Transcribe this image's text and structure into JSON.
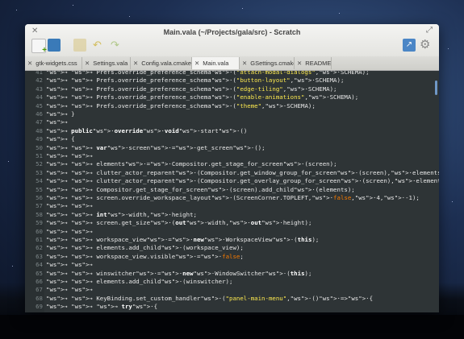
{
  "window": {
    "title": "Main.vala (~/Projects/gala/src) - Scratch"
  },
  "tabs": [
    {
      "label": "gtk-widgets.css",
      "active": false
    },
    {
      "label": "Settings.vala",
      "active": false
    },
    {
      "label": "Config.vala.cmake",
      "active": false
    },
    {
      "label": "Main.vala",
      "active": true
    },
    {
      "label": "GSettings.cmake",
      "active": false
    },
    {
      "label": "README",
      "active": false
    }
  ],
  "toolbar": {
    "icons": [
      "new-document-icon",
      "open-folder-icon",
      "save-icon",
      "undo-icon",
      "redo-icon",
      "share-icon",
      "settings-gear-icon"
    ]
  },
  "colors": {
    "editor_bg": "#2e3436",
    "keyword": "#ffffff",
    "string": "#fce94f",
    "boolean": "#f57900",
    "number": "#ad7fa8"
  },
  "code_lines": [
    {
      "n": "41",
      "text": "→ → Prefs.override_preference_schema·(\"attach-modal-dialogs\",·SCHEMA);"
    },
    {
      "n": "42",
      "text": "→ → Prefs.override_preference_schema·(\"button-layout\",·SCHEMA);"
    },
    {
      "n": "43",
      "text": "→ → Prefs.override_preference_schema·(\"edge-tiling\",·SCHEMA);"
    },
    {
      "n": "44",
      "text": "→ → Prefs.override_preference_schema·(\"enable-animations\",·SCHEMA);"
    },
    {
      "n": "45",
      "text": "→ → Prefs.override_preference_schema·(\"theme\",·SCHEMA);"
    },
    {
      "n": "46",
      "text": "→ }"
    },
    {
      "n": "47",
      "text": "→"
    },
    {
      "n": "48",
      "text": "→ public·override·void·start·()"
    },
    {
      "n": "49",
      "text": "→ {"
    },
    {
      "n": "50",
      "text": "→ → var·screen·=·get_screen·();"
    },
    {
      "n": "51",
      "text": "→ →"
    },
    {
      "n": "52",
      "text": "→ → elements·=·Compositor.get_stage_for_screen·(screen);"
    },
    {
      "n": "53",
      "text": "→ → clutter_actor_reparent·(Compositor.get_window_group_for_screen·(screen),·elements);"
    },
    {
      "n": "54",
      "text": "→ → clutter_actor_reparent·(Compositor.get_overlay_group_for_screen·(screen),·elements);"
    },
    {
      "n": "55",
      "text": "→ → Compositor.get_stage_for_screen·(screen).add_child·(elements);"
    },
    {
      "n": "56",
      "text": "→ → screen.override_workspace_layout·(ScreenCorner.TOPLEFT,·false,·4,·-1);"
    },
    {
      "n": "57",
      "text": "→ →"
    },
    {
      "n": "58",
      "text": "→ → int·width,·height;"
    },
    {
      "n": "59",
      "text": "→ → screen.get_size·(out·width,·out·height);"
    },
    {
      "n": "60",
      "text": "→ →"
    },
    {
      "n": "61",
      "text": "→ → workspace_view·=·new·WorkspaceView·(this);"
    },
    {
      "n": "62",
      "text": "→ → elements.add_child·(workspace_view);"
    },
    {
      "n": "63",
      "text": "→ → workspace_view.visible·=·false;"
    },
    {
      "n": "64",
      "text": "→ →"
    },
    {
      "n": "65",
      "text": "→ → winswitcher·=·new·WindowSwitcher·(this);"
    },
    {
      "n": "66",
      "text": "→ → elements.add_child·(winswitcher);"
    },
    {
      "n": "67",
      "text": "→ →"
    },
    {
      "n": "68",
      "text": "→ → KeyBinding.set_custom_handler·(\"panel-main-menu\",·()·=>·{"
    },
    {
      "n": "69",
      "text": "→ → → try·{"
    }
  ]
}
